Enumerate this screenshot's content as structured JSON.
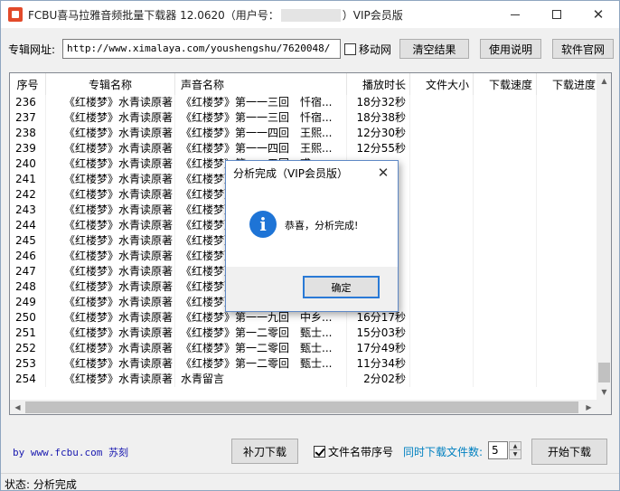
{
  "window": {
    "title_prefix": "FCBU喜马拉雅音频批量下载器 12.0620（用户号：",
    "title_suffix": "）VIP会员版",
    "min_icon": "minimize-icon",
    "max_icon": "maximize-icon",
    "close_glyph": "✕"
  },
  "toolbar": {
    "url_label": "专辑网址:",
    "url_value": "http://www.ximalaya.com/youshengshu/7620048/",
    "mobile_label": "移动网",
    "mobile_checked": false,
    "clear_label": "清空结果",
    "help_label": "使用说明",
    "site_label": "软件官网"
  },
  "table": {
    "columns": [
      "序号",
      "专辑名称",
      "声音名称",
      "播放时长",
      "文件大小",
      "下载速度",
      "下载进度"
    ],
    "rows": [
      [
        "236",
        "《红楼梦》水青读原著",
        "《红楼梦》第一一三回　忏宿...",
        "18分32秒",
        "",
        "",
        ""
      ],
      [
        "237",
        "《红楼梦》水青读原著",
        "《红楼梦》第一一三回　忏宿...",
        "18分38秒",
        "",
        "",
        ""
      ],
      [
        "238",
        "《红楼梦》水青读原著",
        "《红楼梦》第一一四回　王熙...",
        "12分30秒",
        "",
        "",
        ""
      ],
      [
        "239",
        "《红楼梦》水青读原著",
        "《红楼梦》第一一四回　王熙...",
        "12分55秒",
        "",
        "",
        ""
      ],
      [
        "240",
        "《红楼梦》水青读原著",
        "《红楼梦》第一一五回　惑...",
        "",
        "",
        "",
        ""
      ],
      [
        "241",
        "《红楼梦》水青读原著",
        "《红楼梦》",
        "",
        "",
        "",
        ""
      ],
      [
        "242",
        "《红楼梦》水青读原著",
        "《红楼梦》",
        "",
        "",
        "",
        ""
      ],
      [
        "243",
        "《红楼梦》水青读原著",
        "《红楼梦》",
        "",
        "",
        "",
        ""
      ],
      [
        "244",
        "《红楼梦》水青读原著",
        "《红楼梦》",
        "",
        "",
        "",
        ""
      ],
      [
        "245",
        "《红楼梦》水青读原著",
        "《红楼梦》",
        "",
        "",
        "",
        ""
      ],
      [
        "246",
        "《红楼梦》水青读原著",
        "《红楼梦》",
        "",
        "",
        "",
        ""
      ],
      [
        "247",
        "《红楼梦》水青读原著",
        "《红楼梦》",
        "",
        "",
        "",
        ""
      ],
      [
        "248",
        "《红楼梦》水青读原著",
        "《红楼梦》",
        "",
        "",
        "",
        ""
      ],
      [
        "249",
        "《红楼梦》水青读原著",
        "《红楼梦》",
        "",
        "",
        "",
        ""
      ],
      [
        "250",
        "《红楼梦》水青读原著",
        "《红楼梦》第一一九回　中乡...",
        "16分17秒",
        "",
        "",
        ""
      ],
      [
        "251",
        "《红楼梦》水青读原著",
        "《红楼梦》第一二零回　甄士...",
        "15分03秒",
        "",
        "",
        ""
      ],
      [
        "252",
        "《红楼梦》水青读原著",
        "《红楼梦》第一二零回　甄士...",
        "17分49秒",
        "",
        "",
        ""
      ],
      [
        "253",
        "《红楼梦》水青读原著",
        "《红楼梦》第一二零回　甄士...",
        "11分34秒",
        "",
        "",
        ""
      ],
      [
        "254",
        "《红楼梦》水青读原著",
        "水青留言",
        "2分02秒",
        "",
        "",
        ""
      ]
    ]
  },
  "bottom": {
    "credit": "by www.fcbu.com 苏刻",
    "redownload_label": "补刀下载",
    "filename_num_label": "文件名带序号",
    "filename_num_checked": true,
    "concurrent_label": "同时下载文件数:",
    "concurrent_value": "5",
    "start_label": "开始下载"
  },
  "status": {
    "text": "状态: 分析完成"
  },
  "dialog": {
    "title": "分析完成（VIP会员版）",
    "icon": "info-icon",
    "icon_glyph": "i",
    "message": "恭喜，分析完成!",
    "ok_label": "确定",
    "close_glyph": "✕"
  },
  "colors": {
    "accent": "#1e74d6",
    "link": "#1a1ab0",
    "concurrent_label": "#0080c0",
    "app_icon": "#e24a2a"
  }
}
